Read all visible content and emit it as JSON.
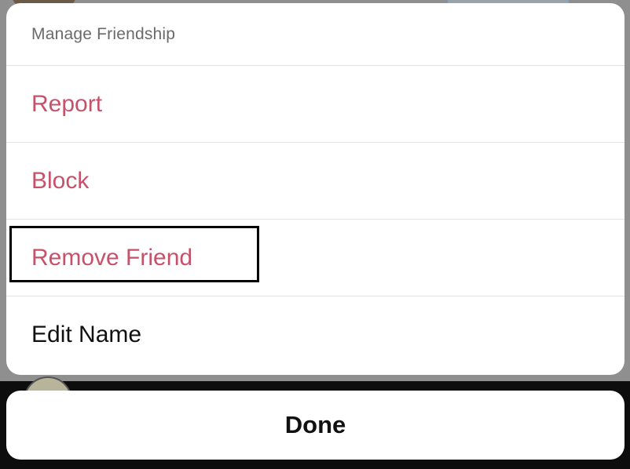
{
  "sheet": {
    "title": "Manage Friendship",
    "items": [
      {
        "label": "Report",
        "style": "destructive"
      },
      {
        "label": "Block",
        "style": "destructive"
      },
      {
        "label": "Remove Friend",
        "style": "destructive",
        "highlighted": true
      },
      {
        "label": "Edit Name",
        "style": "normal"
      }
    ]
  },
  "done": {
    "label": "Done"
  },
  "colors": {
    "destructive": "#c8516a",
    "normal": "#111111",
    "title": "#6a6a6a",
    "highlight_border": "#000000"
  }
}
